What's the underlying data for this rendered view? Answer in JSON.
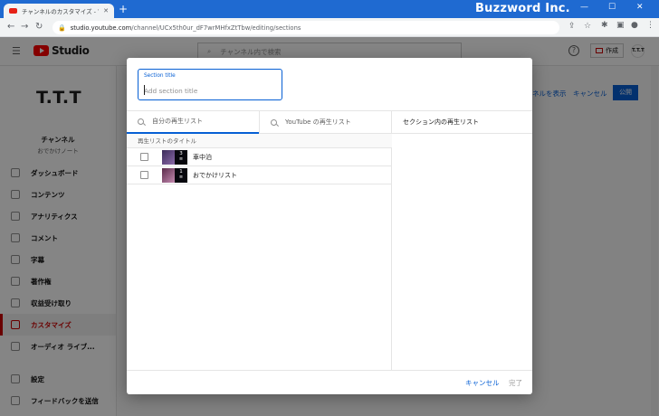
{
  "browser": {
    "tab_title": "チャンネルのカスタマイズ - YouTube S",
    "tab_close": "✕",
    "new_tab": "+",
    "url_host": "studio.youtube.com",
    "url_path": "/channel/UCx5th0ur_dF7wrMHfxZtTbw/editing/sections",
    "watermark": "Buzzword Inc.",
    "window_minimize": "—",
    "window_maximize": "☐",
    "window_close": "✕"
  },
  "studio": {
    "logo_text": "Studio",
    "search_placeholder": "チャンネル内で検索",
    "help": "?",
    "create_label": "作成",
    "avatar_initials": "T.T.T",
    "channel_avatar": "T.T.T",
    "channel_label": "チャンネル",
    "channel_name": "おでかけノート",
    "nav": [
      {
        "label": "ダッシュボード",
        "icon": "dashboard-icon"
      },
      {
        "label": "コンテンツ",
        "icon": "content-icon"
      },
      {
        "label": "アナリティクス",
        "icon": "analytics-icon"
      },
      {
        "label": "コメント",
        "icon": "comments-icon"
      },
      {
        "label": "字幕",
        "icon": "subtitles-icon"
      },
      {
        "label": "著作権",
        "icon": "copyright-icon"
      },
      {
        "label": "収益受け取り",
        "icon": "monetization-icon"
      },
      {
        "label": "カスタマイズ",
        "icon": "customization-icon"
      },
      {
        "label": "オーディオ ライブ...",
        "icon": "audio-library-icon"
      }
    ],
    "nav_bottom": [
      {
        "label": "設定",
        "icon": "settings-icon"
      },
      {
        "label": "フィードバックを送信",
        "icon": "feedback-icon"
      }
    ],
    "view_channel": "ネルを表示",
    "cancel": "キャンセル",
    "publish": "公開"
  },
  "dialog": {
    "title_field_label": "Section title",
    "title_field_placeholder": "Add section title",
    "title_field_value": "",
    "search_tabs": [
      {
        "placeholder": "自分の再生リスト"
      },
      {
        "placeholder": "YouTube の再生リスト"
      }
    ],
    "right_header": "セクション内の再生リスト",
    "list_header": "再生リストのタイトル",
    "playlists": [
      {
        "title": "車中泊",
        "count": "3"
      },
      {
        "title": "おでかけリスト",
        "count": "1"
      }
    ],
    "cancel_label": "キャンセル",
    "done_label": "完了"
  }
}
